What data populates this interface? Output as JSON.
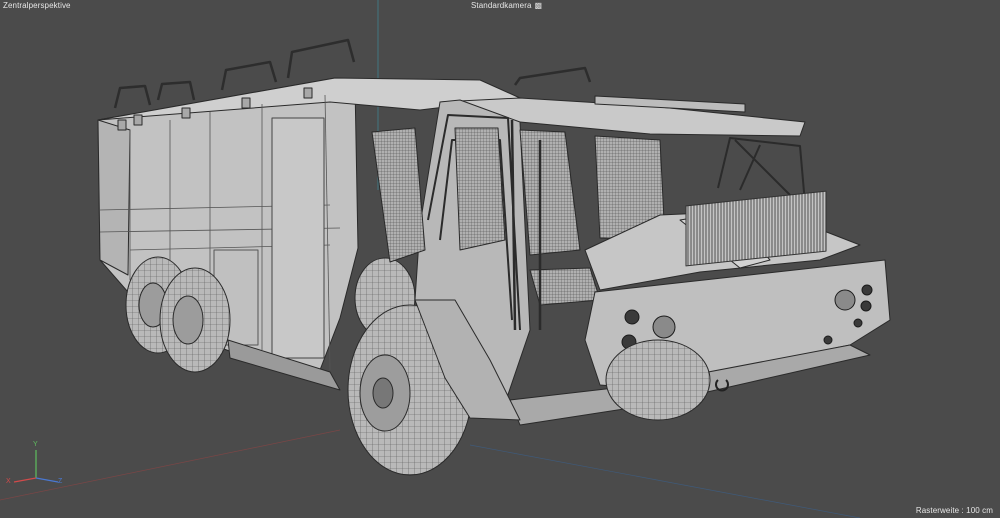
{
  "viewport": {
    "projection_label": "Zentralperspektive",
    "camera_label": "Standardkamera",
    "camera_icon": "camera-icon",
    "grid_size_label": "Rasterweite : 100 cm"
  },
  "axes": {
    "y_label": "Y",
    "x_label": "X",
    "z_label": "Z",
    "colors": {
      "x": "#d24a4a",
      "y": "#5fbf5f",
      "z": "#4a78d2"
    }
  },
  "colors": {
    "background": "#4b4b4b",
    "mesh_fill": "#bdbdbd",
    "wire": "#2a2a2a",
    "text": "#e6e6e6"
  }
}
